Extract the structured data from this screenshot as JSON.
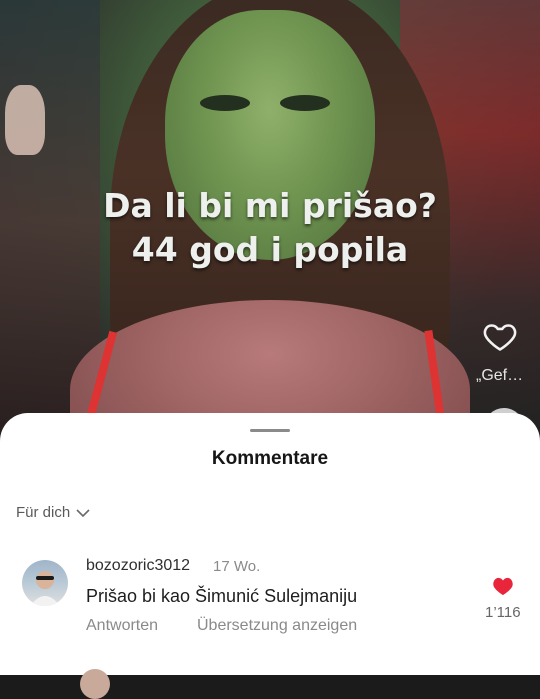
{
  "video": {
    "caption_line1": "Da li bi mi prišao?",
    "caption_line2": "44 god i popila",
    "favorite_label": "„Gef…"
  },
  "comments_sheet": {
    "title": "Kommentare",
    "filter_label": "Für dich",
    "comments": [
      {
        "username": "bozozoric3012",
        "time": "17 Wo.",
        "text": "Prišao bi kao Šimunić Sulejmaniju",
        "reply_label": "Antworten",
        "translate_label": "Übersetzung anzeigen",
        "like_count": "1’116",
        "liked": true
      }
    ]
  },
  "colors": {
    "accent_like": "#e8253a",
    "sheet_bg": "#ffffff"
  },
  "icons": [
    "heart-outline-icon",
    "chevron-down-icon",
    "heart-filled-icon"
  ]
}
